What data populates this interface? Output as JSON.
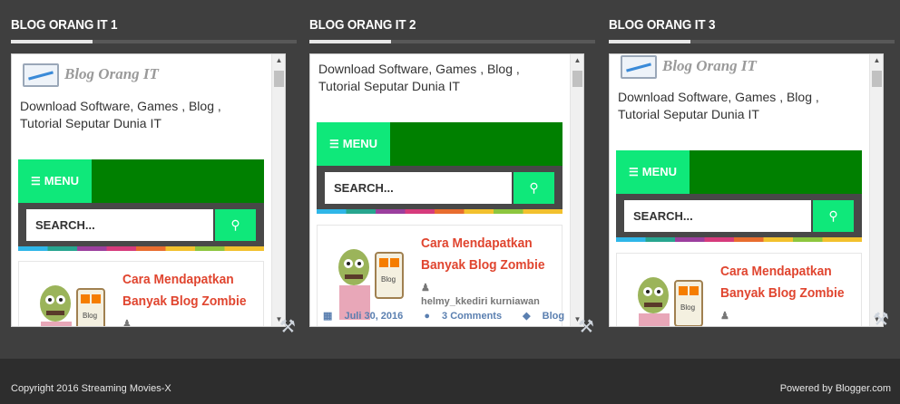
{
  "widgets": [
    {
      "title": "BLOG ORANG IT 1",
      "logo_text": "Blog Orang IT",
      "description": "Download Software, Games , Blog , Tutorial Seputar Dunia IT",
      "menu_label": "MENU",
      "search_placeholder": "SEARCH...",
      "post_title": "Cara Mendapatkan Banyak Blog Zombie"
    },
    {
      "title": "BLOG ORANG IT 2",
      "description": "Download Software, Games , Blog , Tutorial Seputar Dunia IT",
      "menu_label": "MENU",
      "search_placeholder": "SEARCH...",
      "post_title": "Cara Mendapatkan Banyak Blog Zombie",
      "author": "helmy_kkediri kurniawan",
      "date": "Juli 30, 2016",
      "comments": "3 Comments",
      "label": "Blog"
    },
    {
      "title": "BLOG ORANG IT 3",
      "logo_text": "Blog Orang IT",
      "description": "Download Software, Games , Blog , Tutorial Seputar Dunia IT",
      "menu_label": "MENU",
      "search_placeholder": "SEARCH...",
      "post_title": "Cara Mendapatkan Banyak Blog Zombie"
    }
  ],
  "icons": {
    "menu": "list-icon",
    "search": "search-icon",
    "edit": "wrench-screwdriver-icon",
    "user": "user-icon",
    "calendar": "calendar-icon",
    "comment": "comment-icon",
    "tag": "tag-icon"
  },
  "colors": {
    "accent_green": "#0fe87a",
    "menu_bar": "#008000",
    "post_title": "#e0452f"
  },
  "footer": {
    "copyright": "Copyright 2016 Streaming Movies-X",
    "powered": "Powered by Blogger.com"
  }
}
